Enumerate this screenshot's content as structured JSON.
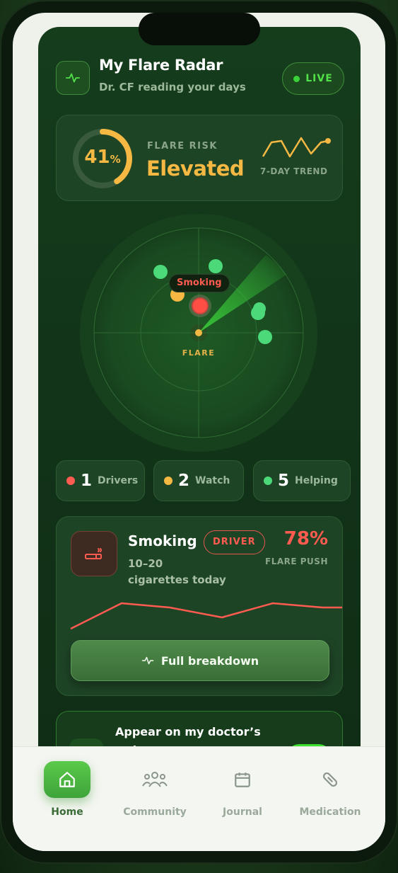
{
  "header": {
    "title": "My Flare Radar",
    "subtitle": "Dr. CF reading your days",
    "live_label": "LIVE"
  },
  "risk": {
    "value": 41,
    "value_text": "41",
    "unit": "%",
    "label": "FLARE RISK",
    "level": "Elevated",
    "trend_label": "7-DAY TREND",
    "colors": {
      "accent": "#f5b843"
    }
  },
  "radar": {
    "selected_tag": "Smoking",
    "center_label": "FLARE"
  },
  "stats": [
    {
      "count": "1",
      "label": "Drivers",
      "color": "#ff5b50"
    },
    {
      "count": "2",
      "label": "Watch",
      "color": "#f5b843"
    },
    {
      "count": "5",
      "label": "Helping",
      "color": "#4cd97a"
    }
  ],
  "driver": {
    "name": "Smoking",
    "badge": "DRIVER",
    "detail_line1": "10–20",
    "detail_line2": "cigarettes today",
    "percent": "78%",
    "percent_label": "FLARE PUSH",
    "button_label": "Full breakdown",
    "icon": "cigarette-icon"
  },
  "doctor": {
    "title": "Appear on my doctor’s radar",
    "toggle_on": true
  },
  "nav": {
    "items": [
      {
        "label": "Home",
        "icon": "home-icon",
        "active": true
      },
      {
        "label": "Community",
        "icon": "community-icon",
        "active": false
      },
      {
        "label": "Journal",
        "icon": "calendar-icon",
        "active": false
      },
      {
        "label": "Medication",
        "icon": "pill-icon",
        "active": false
      }
    ]
  }
}
